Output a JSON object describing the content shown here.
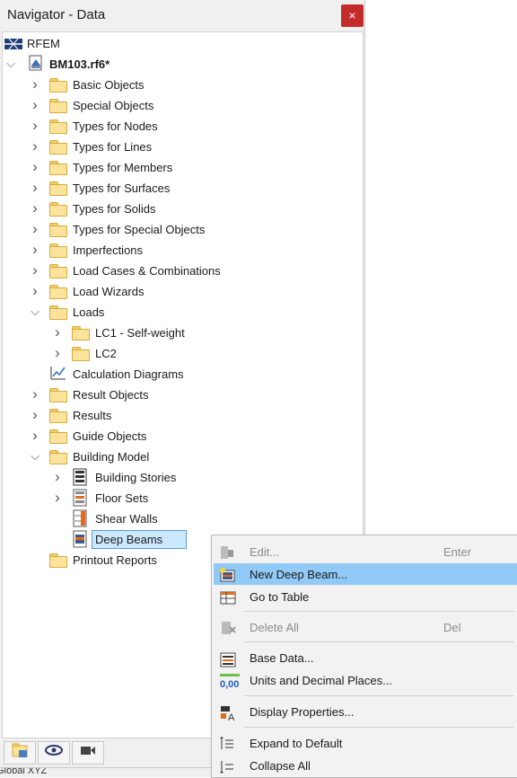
{
  "window": {
    "title": "Navigator - Data",
    "close_glyph": "×"
  },
  "tree": [
    {
      "label": "RFEM",
      "level": 0,
      "chevron": "none",
      "icon": "rfem-icon"
    },
    {
      "label": "BM103.rf6*",
      "level": 0,
      "chevron": "expanded",
      "icon": "model-file-icon",
      "bold": true
    },
    {
      "label": "Basic Objects",
      "level": 1,
      "chevron": "collapsed",
      "icon": "folder-icon"
    },
    {
      "label": "Special Objects",
      "level": 1,
      "chevron": "collapsed",
      "icon": "folder-icon"
    },
    {
      "label": "Types for Nodes",
      "level": 1,
      "chevron": "collapsed",
      "icon": "folder-icon"
    },
    {
      "label": "Types for Lines",
      "level": 1,
      "chevron": "collapsed",
      "icon": "folder-icon"
    },
    {
      "label": "Types for Members",
      "level": 1,
      "chevron": "collapsed",
      "icon": "folder-icon"
    },
    {
      "label": "Types for Surfaces",
      "level": 1,
      "chevron": "collapsed",
      "icon": "folder-icon"
    },
    {
      "label": "Types for Solids",
      "level": 1,
      "chevron": "collapsed",
      "icon": "folder-icon"
    },
    {
      "label": "Types for Special Objects",
      "level": 1,
      "chevron": "collapsed",
      "icon": "folder-icon"
    },
    {
      "label": "Imperfections",
      "level": 1,
      "chevron": "collapsed",
      "icon": "folder-icon"
    },
    {
      "label": "Load Cases & Combinations",
      "level": 1,
      "chevron": "collapsed",
      "icon": "folder-icon"
    },
    {
      "label": "Load Wizards",
      "level": 1,
      "chevron": "collapsed",
      "icon": "folder-icon"
    },
    {
      "label": "Loads",
      "level": 1,
      "chevron": "expanded",
      "icon": "folder-icon"
    },
    {
      "label": "LC1 - Self-weight",
      "level": 2,
      "chevron": "collapsed",
      "icon": "folder-icon"
    },
    {
      "label": "LC2",
      "level": 2,
      "chevron": "collapsed",
      "icon": "folder-icon"
    },
    {
      "label": "Calculation Diagrams",
      "level": 1,
      "chevron": "none",
      "icon": "diagram-icon"
    },
    {
      "label": "Result Objects",
      "level": 1,
      "chevron": "collapsed",
      "icon": "folder-icon"
    },
    {
      "label": "Results",
      "level": 1,
      "chevron": "collapsed",
      "icon": "folder-icon"
    },
    {
      "label": "Guide Objects",
      "level": 1,
      "chevron": "collapsed",
      "icon": "folder-icon"
    },
    {
      "label": "Building Model",
      "level": 1,
      "chevron": "expanded",
      "icon": "folder-icon"
    },
    {
      "label": "Building Stories",
      "level": 2,
      "chevron": "collapsed",
      "icon": "building-stories-icon"
    },
    {
      "label": "Floor Sets",
      "level": 2,
      "chevron": "collapsed",
      "icon": "floor-sets-icon"
    },
    {
      "label": "Shear Walls",
      "level": 2,
      "chevron": "none",
      "icon": "shear-walls-icon"
    },
    {
      "label": "Deep Beams",
      "level": 2,
      "chevron": "none",
      "icon": "deep-beams-icon",
      "selected": true
    },
    {
      "label": "Printout Reports",
      "level": 1,
      "chevron": "none",
      "icon": "folder-icon"
    }
  ],
  "context_menu": {
    "items": [
      {
        "label": "Edit...",
        "shortcut": "Enter",
        "disabled": true,
        "icon": "edit-icon"
      },
      {
        "label": "New Deep Beam...",
        "shortcut": "",
        "highlighted": true,
        "icon": "new-deep-beam-icon"
      },
      {
        "label": "Go to Table",
        "shortcut": "",
        "icon": "table-icon"
      },
      {
        "separator": true
      },
      {
        "label": "Delete All",
        "shortcut": "Del",
        "disabled": true,
        "icon": "delete-all-icon"
      },
      {
        "separator": true
      },
      {
        "label": "Base Data...",
        "shortcut": "",
        "icon": "base-data-icon"
      },
      {
        "label": "Units and Decimal Places...",
        "shortcut": "",
        "icon": "units-icon",
        "icon_text": "0,00"
      },
      {
        "separator": true
      },
      {
        "label": "Display Properties...",
        "shortcut": "",
        "icon": "display-properties-icon"
      },
      {
        "separator": true
      },
      {
        "label": "Expand to Default",
        "shortcut": "",
        "icon": "expand-icon"
      },
      {
        "label": "Collapse All",
        "shortcut": "",
        "icon": "collapse-icon"
      }
    ]
  },
  "bottom_toolbar": [
    "data-view-icon",
    "eye-icon",
    "camera-icon"
  ],
  "status": {
    "text": "Global XYZ"
  },
  "colors": {
    "highlight": "#91c9f7",
    "selection": "#cce8ff",
    "folder": "#fbe39b",
    "close": "#c42b2b"
  }
}
